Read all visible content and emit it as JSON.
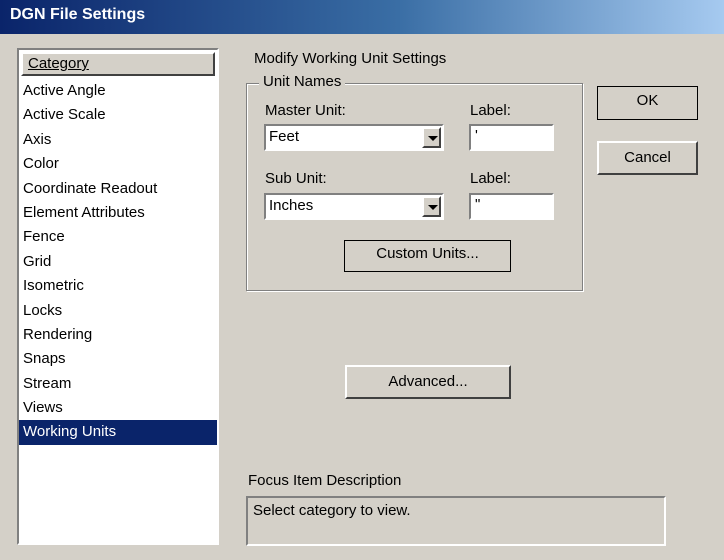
{
  "window": {
    "title": "DGN File Settings"
  },
  "category_list": {
    "header": "Category",
    "items": [
      {
        "label": "Active Angle"
      },
      {
        "label": "Active Scale"
      },
      {
        "label": "Axis"
      },
      {
        "label": "Color"
      },
      {
        "label": "Coordinate Readout"
      },
      {
        "label": "Element Attributes"
      },
      {
        "label": "Fence"
      },
      {
        "label": "Grid"
      },
      {
        "label": "Isometric"
      },
      {
        "label": "Locks"
      },
      {
        "label": "Rendering"
      },
      {
        "label": "Snaps"
      },
      {
        "label": "Stream"
      },
      {
        "label": "Views"
      },
      {
        "label": "Working Units"
      }
    ],
    "selected": "Working Units"
  },
  "panel": {
    "heading": "Modify Working Unit Settings",
    "unit_names_group": "Unit Names",
    "master_unit": {
      "label": "Master Unit:",
      "value": "Feet"
    },
    "master_label": {
      "label": "Label:",
      "value": "'"
    },
    "sub_unit": {
      "label": "Sub Unit:",
      "value": "Inches"
    },
    "sub_label": {
      "label": "Label:",
      "value": "\""
    },
    "custom_units_button": "Custom Units...",
    "advanced_button": "Advanced..."
  },
  "buttons": {
    "ok": "OK",
    "cancel": "Cancel"
  },
  "focus_description": {
    "label": "Focus Item Description",
    "text": "Select category to view."
  }
}
